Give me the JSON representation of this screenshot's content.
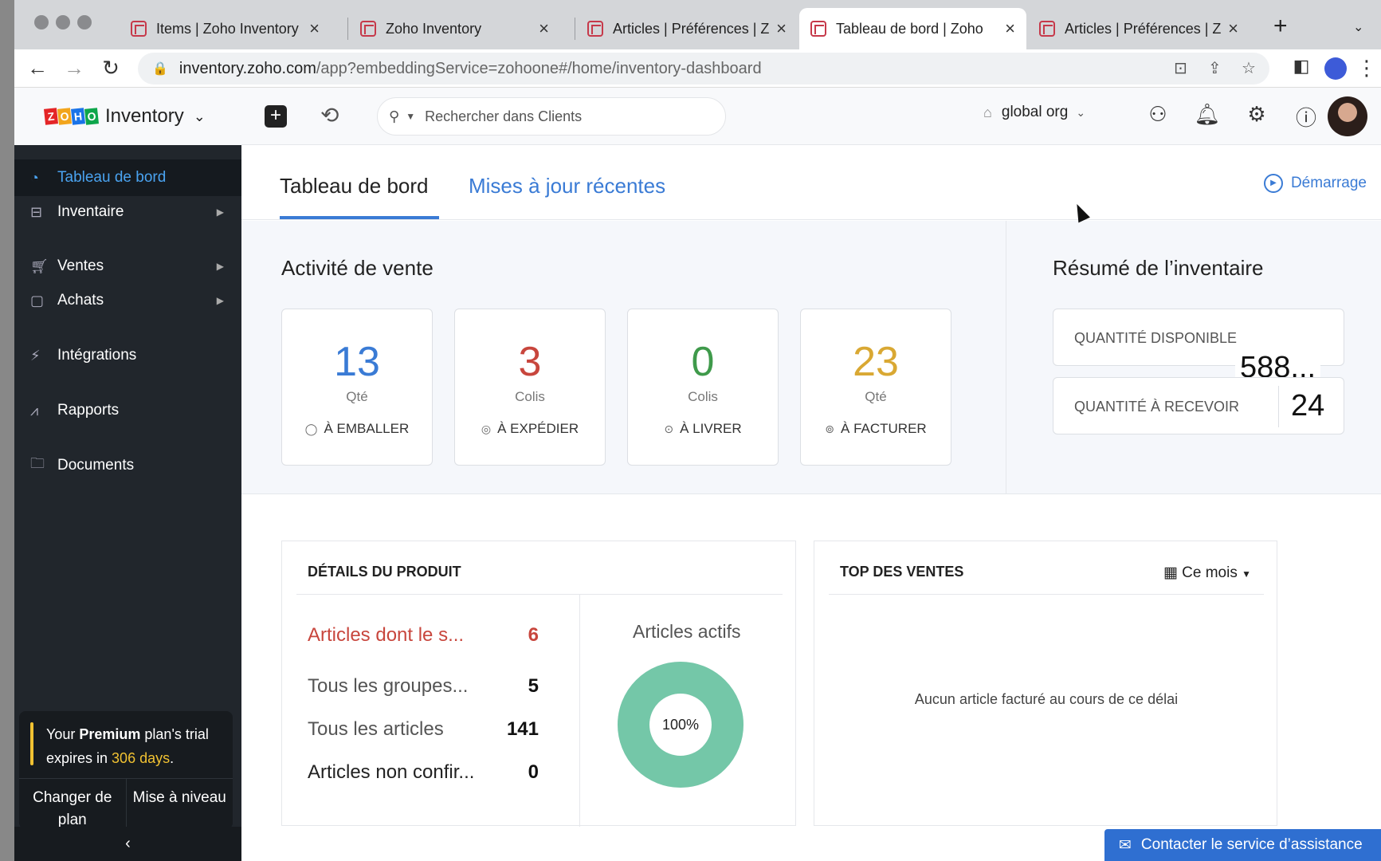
{
  "browser": {
    "tabs": [
      {
        "title": "Items | Zoho Inventory"
      },
      {
        "title": "Zoho Inventory"
      },
      {
        "title": "Articles | Préférences | Z"
      },
      {
        "title": "Tableau de bord | Zoho"
      },
      {
        "title": "Articles | Préférences | Z"
      }
    ],
    "active_tab": 3,
    "new_tab": "+",
    "close": "×",
    "url_domain": "inventory.zoho.com",
    "url_path": "/app?embeddingService=zohoone#/home/inventory-dashboard"
  },
  "header": {
    "app_name": "Inventory",
    "logo_letters": [
      "Z",
      "O",
      "H",
      "O"
    ],
    "logo_colors": [
      "#e42527",
      "#f2a51c",
      "#1a73e8",
      "#0ea64b"
    ],
    "search_placeholder": "Rechercher dans Clients",
    "org_name": "global org"
  },
  "sidebar": {
    "items": [
      {
        "label": "Tableau de bord",
        "icon": "dashboard-icon",
        "active": true
      },
      {
        "label": "Inventaire",
        "icon": "inventory-icon"
      },
      {
        "label": "Ventes",
        "icon": "cart-icon"
      },
      {
        "label": "Achats",
        "icon": "bag-icon"
      },
      {
        "label": "Intégrations",
        "icon": "plug-icon"
      },
      {
        "label": "Rapports",
        "icon": "chart-icon"
      },
      {
        "label": "Documents",
        "icon": "folder-icon"
      }
    ],
    "trial": {
      "part1": "Your ",
      "plan": "Premium",
      "part2": " plan's trial expires in ",
      "days": "306 days",
      "part3": "."
    },
    "btn_change": "Changer de plan",
    "btn_upgrade": "Mise à niveau"
  },
  "content": {
    "tab_dashboard": "Tableau de bord",
    "tab_updates": "Mises à jour récentes",
    "start_link": "Démarrage",
    "sales_title": "Activité de vente",
    "sales_cards": [
      {
        "value": "13",
        "unit": "Qté",
        "label": "À EMBALLER",
        "color": "#3a7bd5"
      },
      {
        "value": "3",
        "unit": "Colis",
        "label": "À EXPÉDIER",
        "color": "#c8463d"
      },
      {
        "value": "0",
        "unit": "Colis",
        "label": "À LIVRER",
        "color": "#3f9a4b"
      },
      {
        "value": "23",
        "unit": "Qté",
        "label": "À FACTURER",
        "color": "#d9a833"
      }
    ],
    "inv_title": "Résumé de l’inventaire",
    "qty_available_label": "QUANTITÉ DISPONIBLE",
    "qty_available_value": "588...",
    "qty_receive_label": "QUANTITÉ À RECEVOIR",
    "qty_receive_value": "24",
    "product_title": "DÉTAILS DU PRODUIT",
    "product_rows": [
      {
        "label": "Articles dont le s...",
        "value": "6"
      },
      {
        "label": "Tous les groupes...",
        "value": "5"
      },
      {
        "label": "Tous les articles",
        "value": "141"
      },
      {
        "label": "Articles non confir...",
        "value": "0"
      }
    ],
    "active_items_title": "Articles actifs",
    "active_items_pct": "100%",
    "active_items_fraction": 1.0,
    "donut_color": "#74c7a8",
    "top_sales_title": "TOP DES VENTES",
    "period": "Ce mois",
    "empty_msg": "Aucun article facturé au cours de ce délai",
    "support": "Contacter le service d’assistance"
  }
}
